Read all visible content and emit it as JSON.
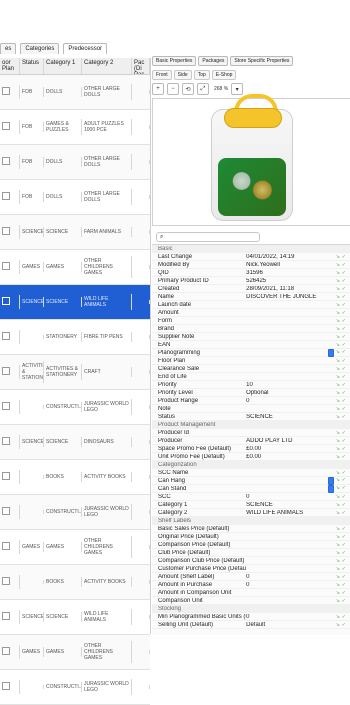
{
  "left": {
    "tabs": [
      {
        "label": "es",
        "active": false
      },
      {
        "label": "Categories",
        "active": false
      },
      {
        "label": "Predecessor",
        "active": true
      }
    ],
    "columns": [
      "oor Plan",
      "Status",
      "Category 1",
      "Category 2",
      "Pac (Di Pac"
    ],
    "rows": [
      {
        "status": "FOB",
        "cat1": "DOLLS",
        "cat2": "OTHER LARGE DOLLS"
      },
      {
        "status": "FOB",
        "cat1": "GAMES & PUZZLES",
        "cat2": "ADULT PUZZLES 1000 PCE"
      },
      {
        "status": "FOB",
        "cat1": "DOLLS",
        "cat2": "OTHER LARGE DOLLS"
      },
      {
        "status": "FOB",
        "cat1": "DOLLS",
        "cat2": "OTHER LARGE DOLLS"
      },
      {
        "status": "SCIENCE",
        "cat1": "SCIENCE",
        "cat2": "FARM ANIMALS"
      },
      {
        "status": "GAMES",
        "cat1": "GAMES",
        "cat2": "OTHER CHILDRENS GAMES"
      },
      {
        "status": "SCIENCE",
        "cat1": "SCIENCE",
        "cat2": "WILD LIFE ANIMALS",
        "selected": true
      },
      {
        "status": "",
        "cat1": "STATIONERY",
        "cat2": "FIBRE TIP PENS"
      },
      {
        "status": "ACTIVITIES & STATION...",
        "cat1": "ACTIVITIES & STATIONERY",
        "cat2": "CRAFT"
      },
      {
        "status": "",
        "cat1": "CONSTRUCTI...",
        "cat2": "JURASSIC WORLD LEGO"
      },
      {
        "status": "SCIENCE",
        "cat1": "SCIENCE",
        "cat2": "DINOSAURS"
      },
      {
        "status": "",
        "cat1": "BOOKS",
        "cat2": "ACTIVITY BOOKS"
      },
      {
        "status": "",
        "cat1": "CONSTRUCTI...",
        "cat2": "JURASSIC WORLD LEGO"
      },
      {
        "status": "GAMES",
        "cat1": "GAMES",
        "cat2": "OTHER CHILDRENS GAMES"
      },
      {
        "status": "",
        "cat1": "BOOKS",
        "cat2": "ACTIVITY BOOKS"
      },
      {
        "status": "SCIENCE",
        "cat1": "SCIENCE",
        "cat2": "WILD LIFE ANIMALS"
      },
      {
        "status": "GAMES",
        "cat1": "GAMES",
        "cat2": "OTHER CHILDRENS GAMES"
      },
      {
        "status": "",
        "cat1": "CONSTRUCTI...",
        "cat2": "JURASSIC WORLD LEGO"
      }
    ]
  },
  "right": {
    "tabs": [
      "Basic Properties",
      "Packages",
      "Store Specific Properties"
    ],
    "active_tab": 0,
    "subtabs": [
      "Front",
      "Side",
      "Top",
      "E-Shop"
    ],
    "active_subtab": 0,
    "zoom": "268 %",
    "search_placeholder": "",
    "properties": [
      {
        "section": "Basic"
      },
      {
        "key": "Last Change",
        "value": "04/01/2022, 14:19"
      },
      {
        "key": "Modified By",
        "value": "Nick.Yeowell"
      },
      {
        "key": "QID",
        "value": "31596"
      },
      {
        "key": "Primary Product ID",
        "value": "526425"
      },
      {
        "key": "Created",
        "value": "28/09/2021, 11:18"
      },
      {
        "key": "Name",
        "value": "DISCOVER THE JUNGLE"
      },
      {
        "key": "Launch date",
        "value": ""
      },
      {
        "key": "Amount",
        "value": ""
      },
      {
        "key": "Form",
        "value": ""
      },
      {
        "key": "Brand",
        "value": ""
      },
      {
        "key": "Supplier Note",
        "value": ""
      },
      {
        "key": "EAN",
        "value": ""
      },
      {
        "key": "Planogramming",
        "value": "",
        "checkbox": true
      },
      {
        "key": "Floor Plan",
        "value": ""
      },
      {
        "key": "Clearance Sale",
        "value": ""
      },
      {
        "key": "End of Life",
        "value": ""
      },
      {
        "key": "Priority",
        "value": "10"
      },
      {
        "key": "Priority Level",
        "value": "Optional"
      },
      {
        "key": "Product Range",
        "value": "0"
      },
      {
        "key": "Note",
        "value": ""
      },
      {
        "key": "Status",
        "value": "SCIENCE"
      },
      {
        "section": "Product Management"
      },
      {
        "key": "Producer Id",
        "value": ""
      },
      {
        "key": "Producer",
        "value": "ADDO PLAY LTD"
      },
      {
        "key": "Space Promo Fee (Default)",
        "value": "£0.00"
      },
      {
        "key": "Unit Promo Fee (Default)",
        "value": "£0.00"
      },
      {
        "section": "Categorization"
      },
      {
        "key": "SCC Name",
        "value": ""
      },
      {
        "key": "Can Hang",
        "value": "",
        "checkbox": true
      },
      {
        "key": "Can Stand",
        "value": "",
        "checkbox": true
      },
      {
        "key": "SCC",
        "value": "0"
      },
      {
        "key": "Category 1",
        "value": "SCIENCE"
      },
      {
        "key": "Category 2",
        "value": "WILD LIFE ANIMALS"
      },
      {
        "section": "Shelf Labels"
      },
      {
        "key": "Basic Sales Price (Default)",
        "value": ""
      },
      {
        "key": "Original Price (Default)",
        "value": ""
      },
      {
        "key": "Comparison Price (Default)",
        "value": ""
      },
      {
        "key": "Club Price (Default)",
        "value": ""
      },
      {
        "key": "Comparison Club Price (Default)",
        "value": ""
      },
      {
        "key": "Customer Purchase Price (Default)",
        "value": ""
      },
      {
        "key": "Amount (Shelf Label)",
        "value": "0"
      },
      {
        "key": "Amount in Purchase",
        "value": "0"
      },
      {
        "key": "Amount in Comparison Unit",
        "value": ""
      },
      {
        "key": "Comparison Unit",
        "value": ""
      },
      {
        "section": "Stocking"
      },
      {
        "key": "Min Planogrammed Basic Units (Default)",
        "value": "0"
      },
      {
        "key": "Selling Unit (Default)",
        "value": "Default"
      }
    ]
  }
}
